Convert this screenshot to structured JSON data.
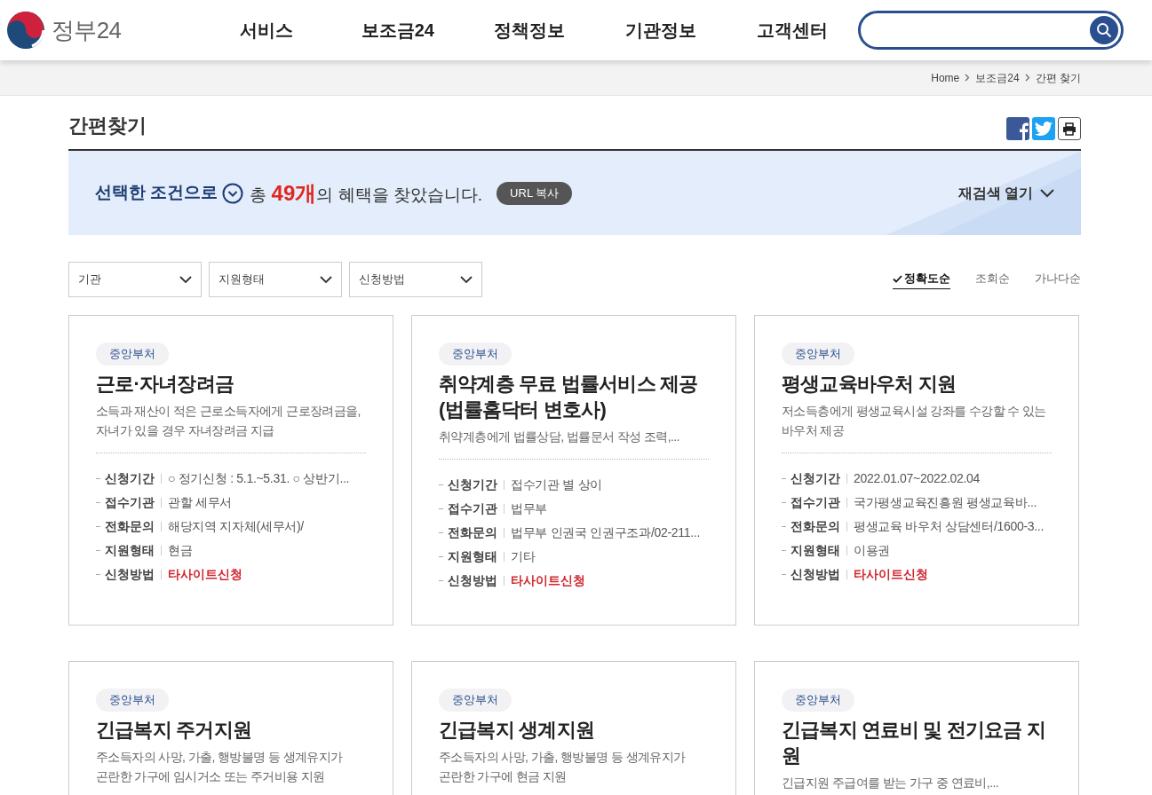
{
  "logo": {
    "text": "정부24"
  },
  "nav": [
    "서비스",
    "보조금24",
    "정책정보",
    "기관정보",
    "고객센터"
  ],
  "breadcrumb": [
    "Home",
    "보조금24",
    "간편 찾기"
  ],
  "page_title": "간편찾기",
  "summary": {
    "condition": "선택한 조건으로",
    "prefix": "총",
    "count": "49개",
    "suffix": "의 혜택을 찾았습니다.",
    "copy_button": "URL 복사",
    "reopen": "재검색 열기"
  },
  "filters": [
    {
      "label": "기관"
    },
    {
      "label": "지원형태"
    },
    {
      "label": "신청방법"
    }
  ],
  "sort_options": [
    {
      "label": "정확도순",
      "selected": true
    },
    {
      "label": "조회순",
      "selected": false
    },
    {
      "label": "가나다순",
      "selected": false
    }
  ],
  "cards": [
    {
      "tag": "중앙부처",
      "title": "근로·자녀장려금",
      "description": "소득과 재산이 적은 근로소득자에게 근로장려금을, 자녀가 있을 경우 자녀장려금 지급",
      "details": [
        {
          "label": "신청기간",
          "value": "○ 정기신청 : 5.1.~5.31. ○ 상반기...",
          "kind": "plain"
        },
        {
          "label": "접수기관",
          "value": "관할 세무서",
          "kind": "plain"
        },
        {
          "label": "전화문의",
          "value": "해당지역 지자체(세무서)/",
          "kind": "plain"
        },
        {
          "label": "지원형태",
          "value": "현금",
          "kind": "plain"
        },
        {
          "label": "신청방법",
          "value": "타사이트신청",
          "kind": "emphasis"
        }
      ]
    },
    {
      "tag": "중앙부처",
      "title": "취약계층 무료 법률서비스 제공 (법률홈닥터 변호사)",
      "description": "취약계층에게 법률상담, 법률문서 작성 조력,...",
      "details": [
        {
          "label": "신청기간",
          "value": "접수기관 별 상이",
          "kind": "plain"
        },
        {
          "label": "접수기관",
          "value": "법무부",
          "kind": "plain"
        },
        {
          "label": "전화문의",
          "value": "법무부 인권국 인권구조과/02-211...",
          "kind": "plain"
        },
        {
          "label": "지원형태",
          "value": "기타",
          "kind": "plain"
        },
        {
          "label": "신청방법",
          "value": "타사이트신청",
          "kind": "emphasis"
        }
      ]
    },
    {
      "tag": "중앙부처",
      "title": "평생교육바우처 지원",
      "description": "저소득층에게 평생교육시설 강좌를 수강할 수 있는 바우처 제공",
      "details": [
        {
          "label": "신청기간",
          "value": "2022.01.07~2022.02.04",
          "kind": "plain"
        },
        {
          "label": "접수기관",
          "value": "국가평생교육진흥원 평생교육바...",
          "kind": "plain"
        },
        {
          "label": "전화문의",
          "value": "평생교육 바우처 상담센터/1600-3...",
          "kind": "plain"
        },
        {
          "label": "지원형태",
          "value": "이용권",
          "kind": "plain"
        },
        {
          "label": "신청방법",
          "value": "타사이트신청",
          "kind": "emphasis"
        }
      ]
    },
    {
      "tag": "중앙부처",
      "title": "긴급복지 주거지원",
      "description": "주소득자의 사망, 가출, 행방불명 등 생계유지가 곤란한 가구에 임시거소 또는 주거비용 지원"
    },
    {
      "tag": "중앙부처",
      "title": "긴급복지 생계지원",
      "description": "주소득자의 사망, 가출, 행방불명 등 생계유지가 곤란한 가구에 현금 지원"
    },
    {
      "tag": "중앙부처",
      "title": "긴급복지 연료비 및 전기요금 지원",
      "description": "긴급지원 주급여를 받는 가구 중 연료비,..."
    }
  ]
}
